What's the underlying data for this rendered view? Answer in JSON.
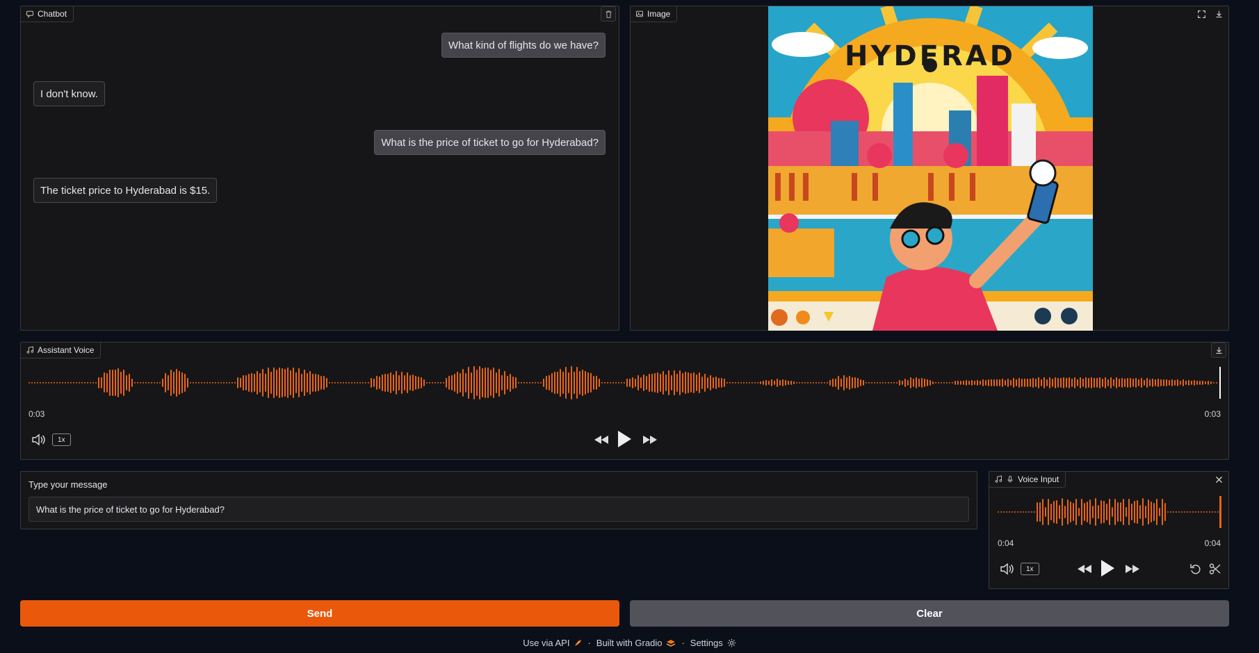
{
  "chatbot": {
    "label": "Chatbot",
    "messages": [
      {
        "role": "user",
        "text": "What kind of flights do we have?"
      },
      {
        "role": "bot",
        "text": "I don't know."
      },
      {
        "role": "user",
        "text": "What is the price of ticket to go for Hyderabad?"
      },
      {
        "role": "bot",
        "text": "The ticket price to Hyderabad is $15."
      }
    ]
  },
  "image_panel": {
    "label": "Image",
    "poster_title": "HYDERAD"
  },
  "assistant_voice": {
    "label": "Assistant Voice",
    "time_start": "0:03",
    "time_end": "0:03",
    "playback_rate": "1x"
  },
  "message_input": {
    "label": "Type your message",
    "value": "What is the price of ticket to go for Hyderabad?"
  },
  "voice_input": {
    "label": "Voice Input",
    "time_start": "0:04",
    "time_end": "0:04",
    "playback_rate": "1x"
  },
  "buttons": {
    "send": "Send",
    "clear": "Clear"
  },
  "footer": {
    "api": "Use via API",
    "built": "Built with Gradio",
    "settings": "Settings",
    "sep": "·"
  },
  "colors": {
    "accent": "#e8651a",
    "clear_button": "#52525b"
  },
  "icons": [
    "chat-icon",
    "trash-icon",
    "image-icon",
    "fullscreen-icon",
    "download-icon",
    "music-icon",
    "volume-icon",
    "rewind-icon",
    "play-icon",
    "fast-forward-icon",
    "microphone-icon",
    "close-icon",
    "undo-icon",
    "scissors-icon",
    "rocket-icon",
    "gradio-logo-icon",
    "gear-icon"
  ]
}
